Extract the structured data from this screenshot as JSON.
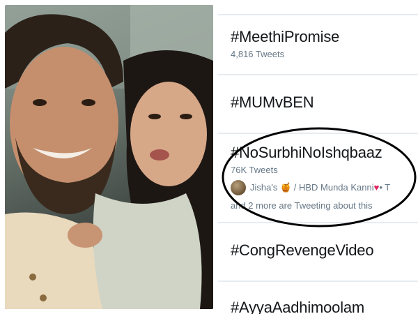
{
  "trends": [
    {
      "tag": "#MeethiPromise",
      "count": "4,816 Tweets"
    },
    {
      "tag": "#MUMvBEN",
      "count": ""
    },
    {
      "tag": "#NoSurbhiNoIshqbaaz",
      "count": "76K Tweets",
      "tweeting_users": "Jisha's 🍯 / HBD Munda Kanni",
      "heart": "♥",
      "tweeting_more": "• T",
      "tweeting_suffix": "and 2 more are Tweeting about this"
    },
    {
      "tag": "#CongRevengeVideo",
      "count": ""
    },
    {
      "tag": "#AyyaAadhimoolam",
      "count": ""
    }
  ],
  "colors": {
    "text": "#14171a",
    "secondary": "#657786",
    "divider": "#e6ecf0",
    "heart": "#e0245e",
    "highlight_ellipse": "#000000"
  }
}
